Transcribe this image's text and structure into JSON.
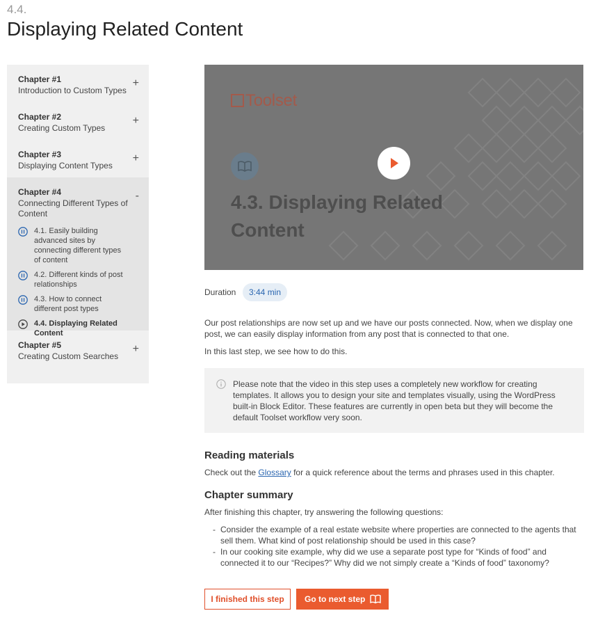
{
  "header": {
    "step_number": "4.4.",
    "title": "Displaying Related Content"
  },
  "sidebar": {
    "chapters": [
      {
        "name": "Chapter #1",
        "title": "Introduction to Custom Types",
        "toggle": "+"
      },
      {
        "name": "Chapter #2",
        "title": "Creating Custom Types",
        "toggle": "+"
      },
      {
        "name": "Chapter #3",
        "title": "Displaying Content Types",
        "toggle": "+"
      },
      {
        "name": "Chapter #4",
        "title": "Connecting Different Types of Content",
        "toggle": "-",
        "lessons": [
          {
            "label": "4.1. Easily building advanced sites by connecting different types of content",
            "icon": "pause-circle-icon"
          },
          {
            "label": "4.2. Different kinds of post relationships",
            "icon": "pause-circle-icon"
          },
          {
            "label": "4.3. How to connect different post types",
            "icon": "pause-circle-icon"
          },
          {
            "label": "4.4. Displaying Related Content",
            "icon": "play-circle-icon"
          }
        ]
      },
      {
        "name": "Chapter #5",
        "title": "Creating Custom Searches",
        "toggle": "+"
      }
    ]
  },
  "video": {
    "brand": "Toolset",
    "heading": "4.3. Displaying Related Content",
    "play_icon": "play-icon",
    "book_icon": "book-icon"
  },
  "duration": {
    "label": "Duration",
    "value": "3:44 min"
  },
  "content": {
    "intro": "Our post relationships are now set up and we have our posts connected. Now, when we display one post, we can easily display information from any post that is connected to that one.",
    "intro2": "In this last step, we see how to do this.",
    "note": "Please note that the video in this step uses a completely new workflow for creating templates. It allows you to design your site and templates visually, using the WordPress built-in Block Editor. These features are currently in open beta but they will become the default Toolset workflow very soon.",
    "reading_title": "Reading materials",
    "reading_before": "Check out the ",
    "reading_link": "Glossary",
    "reading_after": " for a quick reference about the terms and phrases used in this chapter.",
    "summary_title": "Chapter summary",
    "summary_intro": "After finishing this chapter, try answering the following questions:",
    "questions": [
      "Consider the example of a real estate website where properties are connected to the agents that sell them. What kind of post relationship should be used in this case?",
      "In our cooking site example, why did we use a separate post type for “Kinds of food” and connected it to our “Recipes?” Why did we not simply create a “Kinds of food” taxonomy?"
    ]
  },
  "actions": {
    "finished_label": "I finished this step",
    "next_label": "Go to next step"
  },
  "colors": {
    "accent": "#ea5b2f",
    "link": "#2b66b0",
    "sidebar_bg": "#f0f0f0",
    "video_bg": "#767676"
  }
}
